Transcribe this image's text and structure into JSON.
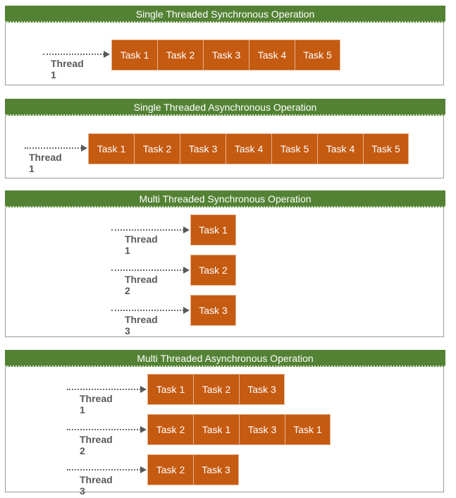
{
  "panels": [
    {
      "title": "Single Threaded Synchronous Operation",
      "rows": [
        {
          "thread": "Thread 1",
          "tasks": [
            "Task 1",
            "Task 2",
            "Task 3",
            "Task 4",
            "Task 5"
          ]
        }
      ]
    },
    {
      "title": "Single Threaded Asynchronous Operation",
      "rows": [
        {
          "thread": "Thread 1",
          "tasks": [
            "Task 1",
            "Task 2",
            "Task 3",
            "Task 4",
            "Task 5",
            "Task 4",
            "Task 5"
          ]
        }
      ]
    },
    {
      "title": "Multi Threaded Synchronous Operation",
      "rows": [
        {
          "thread": "Thread 1",
          "tasks": [
            "Task 1"
          ]
        },
        {
          "thread": "Thread 2",
          "tasks": [
            "Task 2"
          ]
        },
        {
          "thread": "Thread 3",
          "tasks": [
            "Task 3"
          ]
        }
      ]
    },
    {
      "title": "Multi Threaded Asynchronous Operation",
      "rows": [
        {
          "thread": "Thread 1",
          "tasks": [
            "Task 1",
            "Task 2",
            "Task 3"
          ]
        },
        {
          "thread": "Thread 2",
          "tasks": [
            "Task 2",
            "Task 1",
            "Task 3",
            "Task 1"
          ]
        },
        {
          "thread": "Thread 3",
          "tasks": [
            "Task 2",
            "Task 3"
          ]
        }
      ]
    }
  ],
  "colors": {
    "header_green": "#548235",
    "task_orange": "#c55a11",
    "thread_gray": "#595959",
    "panel_border": "#9a9a9a"
  }
}
